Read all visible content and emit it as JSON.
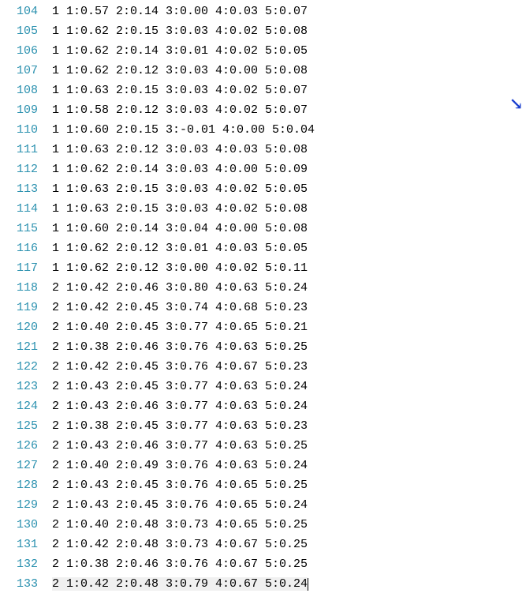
{
  "editor": {
    "lines": [
      {
        "no": "104",
        "text": "1 1:0.57 2:0.14 3:0.00 4:0.03 5:0.07"
      },
      {
        "no": "105",
        "text": "1 1:0.62 2:0.15 3:0.03 4:0.02 5:0.08"
      },
      {
        "no": "106",
        "text": "1 1:0.62 2:0.14 3:0.01 4:0.02 5:0.05"
      },
      {
        "no": "107",
        "text": "1 1:0.62 2:0.12 3:0.03 4:0.00 5:0.08"
      },
      {
        "no": "108",
        "text": "1 1:0.63 2:0.15 3:0.03 4:0.02 5:0.07"
      },
      {
        "no": "109",
        "text": "1 1:0.58 2:0.12 3:0.03 4:0.02 5:0.07"
      },
      {
        "no": "110",
        "text": "1 1:0.60 2:0.15 3:-0.01 4:0.00 5:0.04"
      },
      {
        "no": "111",
        "text": "1 1:0.63 2:0.12 3:0.03 4:0.03 5:0.08"
      },
      {
        "no": "112",
        "text": "1 1:0.62 2:0.14 3:0.03 4:0.00 5:0.09"
      },
      {
        "no": "113",
        "text": "1 1:0.63 2:0.15 3:0.03 4:0.02 5:0.05"
      },
      {
        "no": "114",
        "text": "1 1:0.63 2:0.15 3:0.03 4:0.02 5:0.08"
      },
      {
        "no": "115",
        "text": "1 1:0.60 2:0.14 3:0.04 4:0.00 5:0.08"
      },
      {
        "no": "116",
        "text": "1 1:0.62 2:0.12 3:0.01 4:0.03 5:0.05"
      },
      {
        "no": "117",
        "text": "1 1:0.62 2:0.12 3:0.00 4:0.02 5:0.11"
      },
      {
        "no": "118",
        "text": "2 1:0.42 2:0.46 3:0.80 4:0.63 5:0.24"
      },
      {
        "no": "119",
        "text": "2 1:0.42 2:0.45 3:0.74 4:0.68 5:0.23"
      },
      {
        "no": "120",
        "text": "2 1:0.40 2:0.45 3:0.77 4:0.65 5:0.21"
      },
      {
        "no": "121",
        "text": "2 1:0.38 2:0.46 3:0.76 4:0.63 5:0.25"
      },
      {
        "no": "122",
        "text": "2 1:0.42 2:0.45 3:0.76 4:0.67 5:0.23"
      },
      {
        "no": "123",
        "text": "2 1:0.43 2:0.45 3:0.77 4:0.63 5:0.24"
      },
      {
        "no": "124",
        "text": "2 1:0.43 2:0.46 3:0.77 4:0.63 5:0.24"
      },
      {
        "no": "125",
        "text": "2 1:0.38 2:0.45 3:0.77 4:0.63 5:0.23"
      },
      {
        "no": "126",
        "text": "2 1:0.43 2:0.46 3:0.77 4:0.63 5:0.25"
      },
      {
        "no": "127",
        "text": "2 1:0.40 2:0.49 3:0.76 4:0.63 5:0.24"
      },
      {
        "no": "128",
        "text": "2 1:0.43 2:0.45 3:0.76 4:0.65 5:0.25"
      },
      {
        "no": "129",
        "text": "2 1:0.43 2:0.45 3:0.76 4:0.65 5:0.24"
      },
      {
        "no": "130",
        "text": "2 1:0.40 2:0.48 3:0.73 4:0.65 5:0.25"
      },
      {
        "no": "131",
        "text": "2 1:0.42 2:0.48 3:0.73 4:0.67 5:0.25"
      },
      {
        "no": "132",
        "text": "2 1:0.38 2:0.46 3:0.76 4:0.67 5:0.25"
      },
      {
        "no": "133",
        "text": "2 1:0.42 2:0.48 3:0.79 4:0.67 5:0.24",
        "current": true
      }
    ]
  }
}
